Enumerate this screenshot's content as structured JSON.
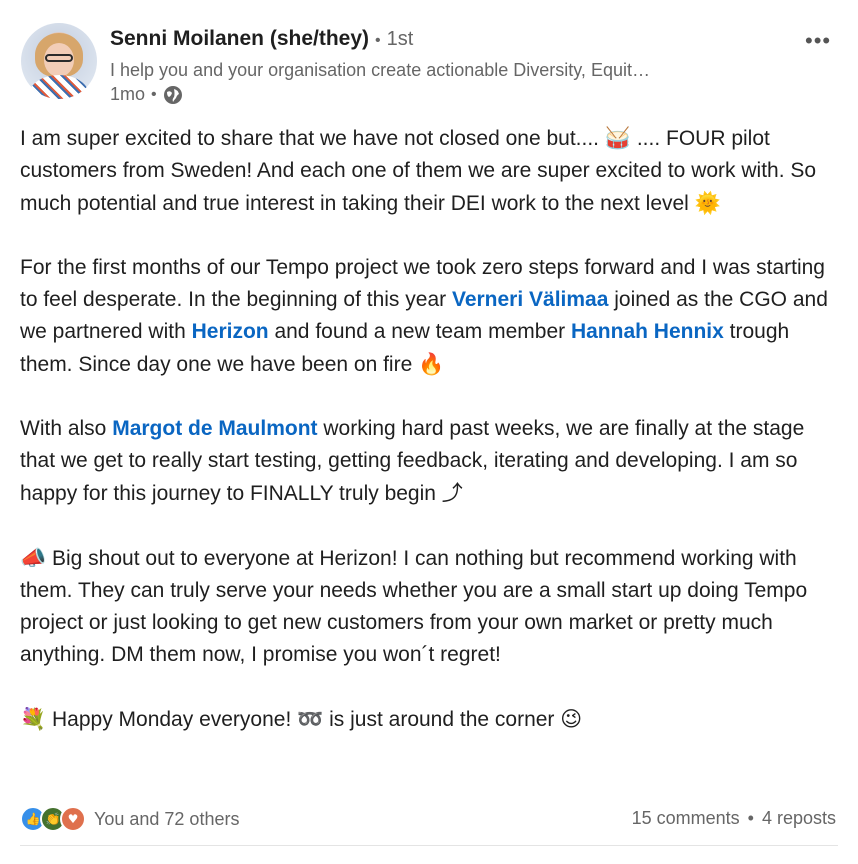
{
  "author": {
    "name": "Senni Moilanen (she/they)",
    "degree": "1st",
    "headline": "I help you and your organisation create actionable Diversity, Equit…",
    "time": "1mo",
    "separator": "•"
  },
  "post": {
    "p1": {
      "a": "I am super excited to share that we have not closed one but.... ",
      "emoji1": "🥁",
      "b": " .... FOUR pilot customers from Sweden! And each one of them we are super excited to work with. So much potential and true interest in taking their DEI work to the next level ",
      "emoji2": "🌞"
    },
    "p2": {
      "a": "For the first months of our Tempo project we took zero steps forward and I was starting to feel desperate. In the beginning of this year ",
      "mention1": "Verneri Välimaa",
      "b": " joined as the CGO and we partnered with ",
      "mention2": "Herizon",
      "c": " and found a new team member ",
      "mention3": "Hannah Hennix",
      "d": " trough them. Since day one we have been on fire ",
      "emoji": "🔥"
    },
    "p3": {
      "a": "With also ",
      "mention1": "Margot de Maulmont",
      "b": " working hard past weeks, we are finally at the stage that we get to really start testing, getting feedback, iterating and developing. I am so happy for this journey to FINALLY truly begin ",
      "emoji": "⤴"
    },
    "p4": {
      "emoji": "📣",
      "a": " Big shout out to everyone at Herizon! I can nothing but recommend working with them. They can truly serve your needs whether you are a small start up doing Tempo project or just looking to get new customers from your own market or pretty much anything. DM them now, I promise you won´t regret!"
    },
    "p5": {
      "emoji1": "💐",
      "a": " Happy Monday everyone! ",
      "emoji2": "➿",
      "b": " is just around the corner ",
      "emoji3": "😉"
    }
  },
  "social": {
    "reactions_text": "You and 72 others",
    "comments": "15 comments",
    "reposts": "4 reposts",
    "separator": "•",
    "reaction_icons": [
      "like-icon",
      "celebrate-icon",
      "love-icon"
    ]
  },
  "icons": {
    "more": "•••",
    "like": "👍",
    "celebrate": "👏",
    "love": "♥"
  }
}
